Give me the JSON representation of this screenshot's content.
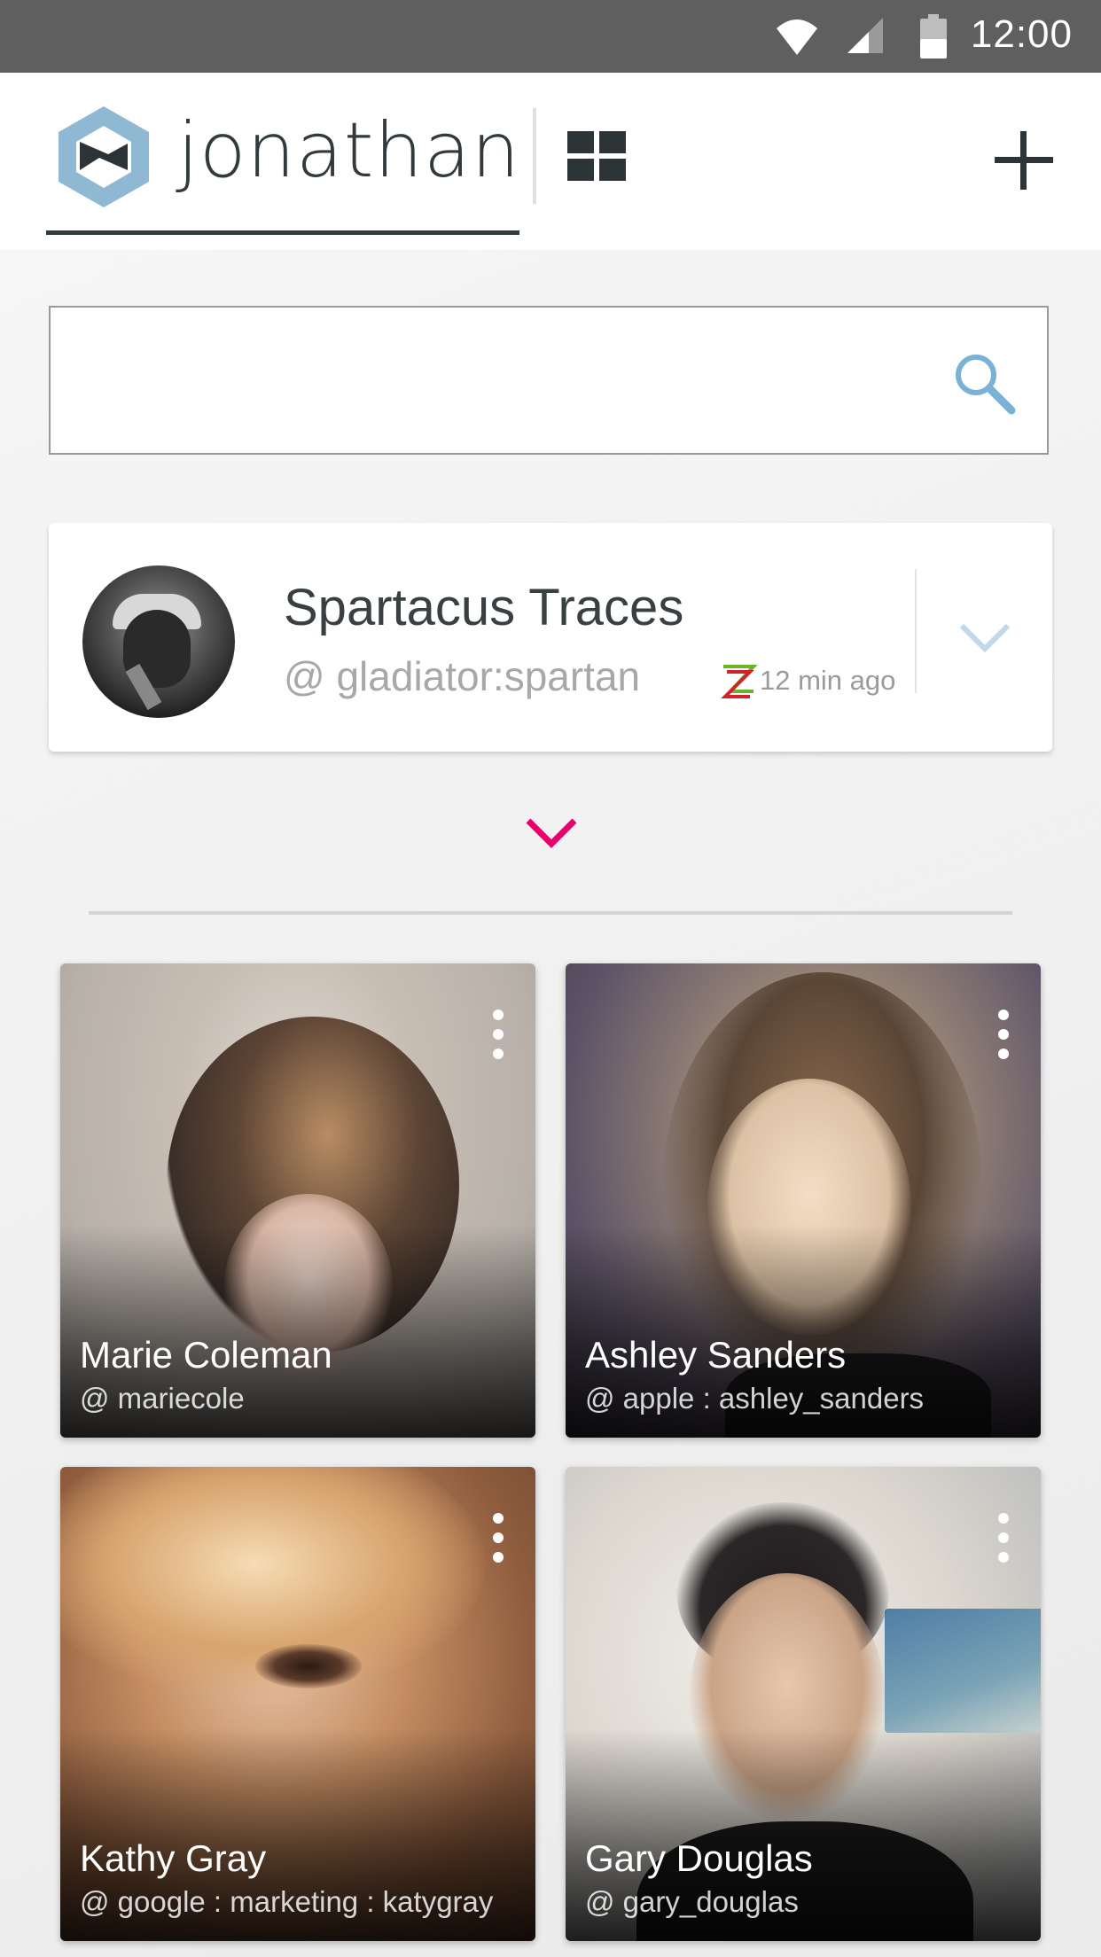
{
  "status_bar": {
    "time": "12:00"
  },
  "header": {
    "username": "jonathan"
  },
  "search": {
    "value": "",
    "placeholder": ""
  },
  "profile_card": {
    "name": "Spartacus Traces",
    "handle": "@ gladiator:spartan",
    "time": "12 min ago"
  },
  "contacts": [
    {
      "name": "Marie Coleman",
      "handle": "@ mariecole"
    },
    {
      "name": "Ashley Sanders",
      "handle": "@ apple : ashley_sanders"
    },
    {
      "name": "Kathy Gray",
      "handle": "@ google : marketing : katygray"
    },
    {
      "name": "Gary Douglas",
      "handle": "@ gary_douglas"
    }
  ],
  "colors": {
    "accent": "#e8006e",
    "logo": "#8fb9d3",
    "search_icon": "#7ab2d6",
    "dark": "#2c3437"
  },
  "icons": [
    "wifi-icon",
    "signal-icon",
    "battery-icon",
    "logo-icon",
    "grid-view-icon",
    "add-icon",
    "search-icon",
    "chevron-down-icon",
    "more-vertical-icon"
  ]
}
